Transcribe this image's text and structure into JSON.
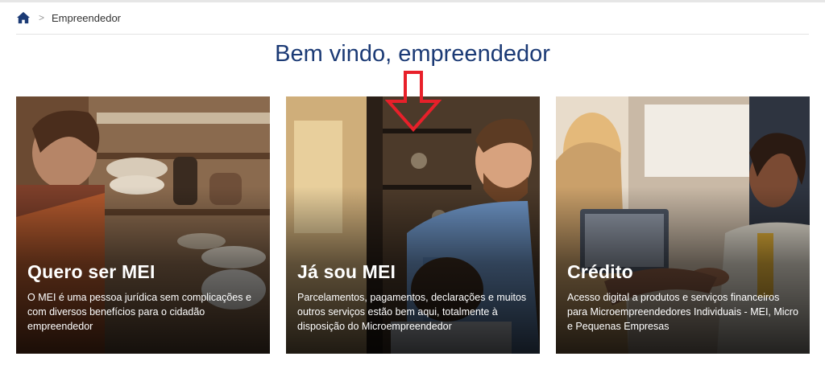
{
  "breadcrumb": {
    "home_icon": "home-icon",
    "separator": ">",
    "current": "Empreendedor"
  },
  "page": {
    "title": "Bem vindo, empreendedor"
  },
  "cards": [
    {
      "title": "Quero ser MEI",
      "description": "O MEI é uma pessoa jurídica sem complicações e com diversos benefícios para o cidadão empreendedor"
    },
    {
      "title": "Já sou MEI",
      "description": "Parcelamentos, pagamentos, declarações e muitos outros serviços estão bem aqui, totalmente à disposição do Microempreendedor"
    },
    {
      "title": "Crédito",
      "description": "Acesso digital a produtos e serviços financeiros para Microempreendedores Individuais - MEI, Micro e Pequenas Empresas"
    }
  ],
  "colors": {
    "title": "#1b3a75",
    "arrow": "#e8202a",
    "home_icon": "#1b3a75"
  }
}
